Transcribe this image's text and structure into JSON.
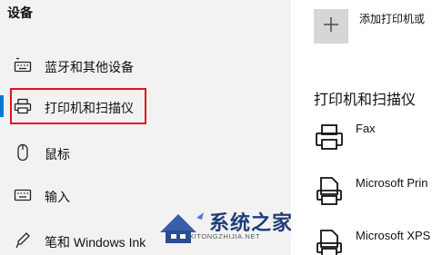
{
  "sidebar": {
    "title": "设备",
    "items": [
      {
        "label": "蓝牙和其他设备",
        "icon": "keyboard-bluetooth-icon"
      },
      {
        "label": "打印机和扫描仪",
        "icon": "printer-icon"
      },
      {
        "label": "鼠标",
        "icon": "mouse-icon"
      },
      {
        "label": "输入",
        "icon": "keyboard-icon"
      },
      {
        "label": "笔和 Windows Ink",
        "icon": "pen-icon"
      }
    ]
  },
  "main": {
    "add_label": "添加打印机或",
    "section_title": "打印机和扫描仪",
    "devices": [
      {
        "name": "Fax",
        "icon": "fax-printer-icon"
      },
      {
        "name": "Microsoft Prin",
        "icon": "document-printer-icon"
      },
      {
        "name": "Microsoft XPS",
        "icon": "document-printer-icon"
      }
    ]
  },
  "watermark": {
    "text": "系统之家",
    "sub": "XITONGZHIJIA.NET"
  },
  "colors": {
    "accent": "#0078d7",
    "highlight": "#e0141e",
    "sidebar_bg": "#f2f2f2"
  }
}
